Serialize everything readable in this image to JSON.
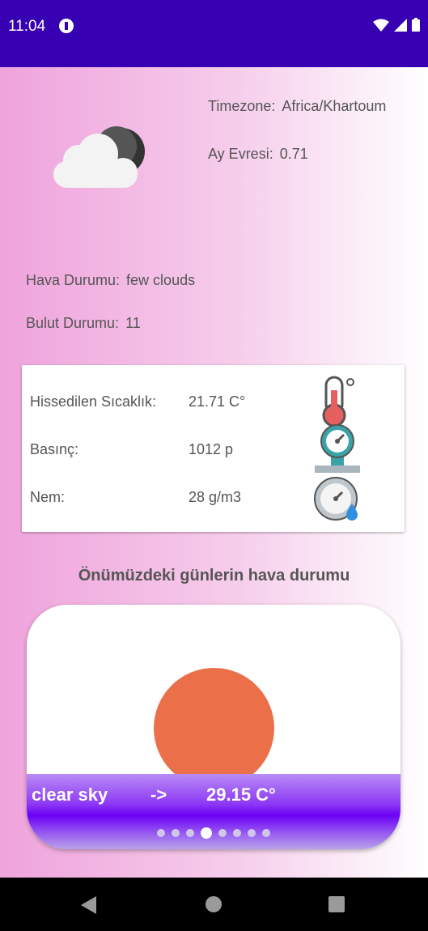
{
  "status": {
    "time": "11:04"
  },
  "info": {
    "timezone_label": "Timezone:",
    "timezone_value": "Africa/Khartoum",
    "moon_label": "Ay Evresi:",
    "moon_value": "0.71",
    "weather_label": "Hava Durumu:",
    "weather_value": "few clouds",
    "cloud_label": "Bulut Durumu:",
    "cloud_value": "11",
    "weather_icon": "cloud-moon-icon"
  },
  "details": [
    {
      "label": "Hissedilen Sıcaklık:",
      "value": "21.71 C°",
      "icon": "thermometer-icon"
    },
    {
      "label": "Basınç:",
      "value": "1012 p",
      "icon": "pressure-gauge-icon"
    },
    {
      "label": "Nem:",
      "value": "28 g/m3",
      "icon": "humidity-gauge-icon"
    }
  ],
  "forecast": {
    "title": "Önümüzdeki günlerin hava durumu",
    "description": "clear sky",
    "arrow": "->",
    "temperature": "29.15 C°",
    "page_count": 8,
    "active_page": 4,
    "icon": "sun-icon"
  },
  "colors": {
    "status_bar": "#3700B3",
    "sun": "#EB704A",
    "forecast_bar": "#6a00f4"
  }
}
